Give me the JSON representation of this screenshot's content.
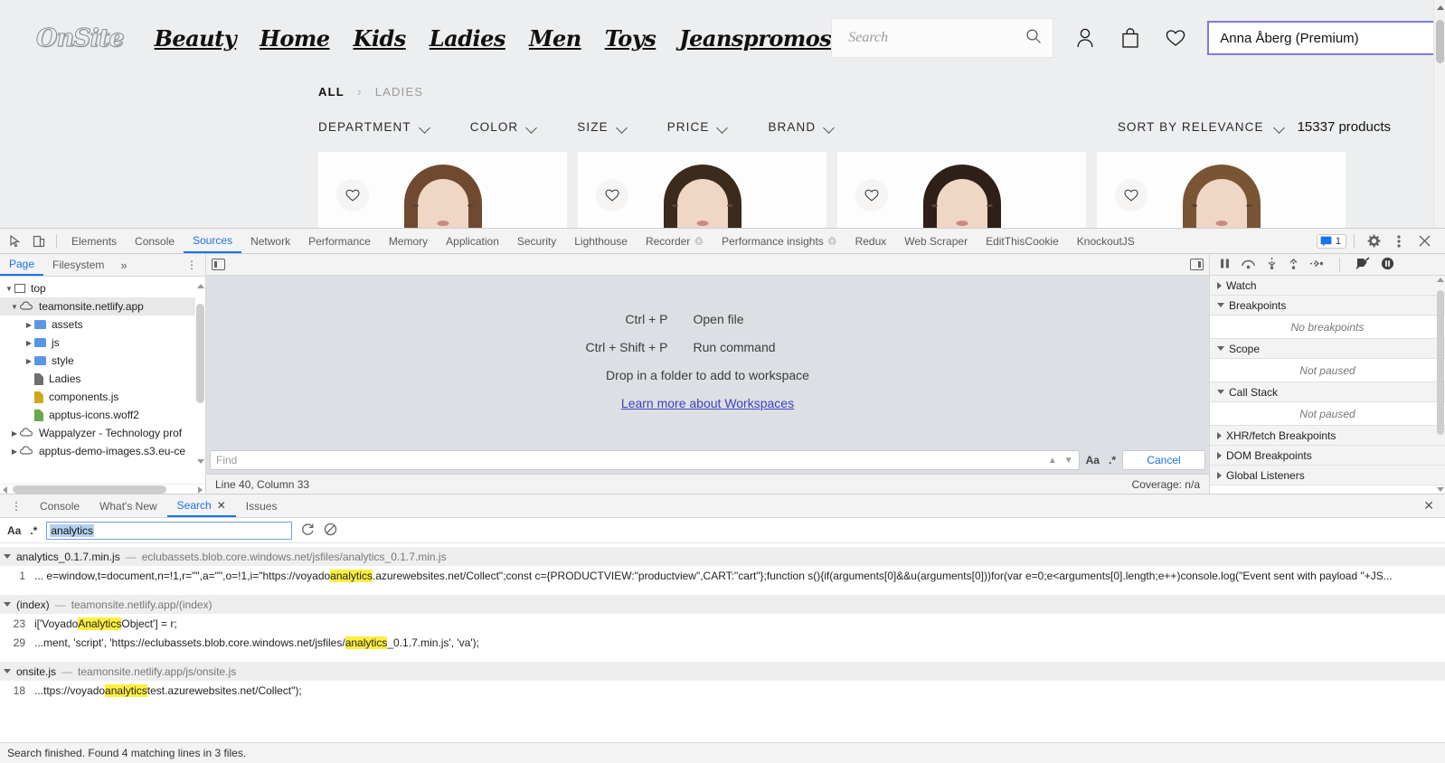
{
  "site": {
    "logo": "OnSite",
    "nav": [
      "Beauty",
      "Home",
      "Kids",
      "Ladies",
      "Men",
      "Toys",
      "Jeanspromos"
    ],
    "search_placeholder": "Search",
    "user_select_value": "Anna Åberg (Premium)",
    "breadcrumb": {
      "root": "ALL",
      "separator": "›",
      "current": "LADIES"
    },
    "filters": [
      "DEPARTMENT",
      "COLOR",
      "SIZE",
      "PRICE",
      "BRAND"
    ],
    "sort_label": "SORT BY RELEVANCE",
    "product_count": "15337 products",
    "cards": [
      {
        "hair": "#6f4a30"
      },
      {
        "hair": "#3c2a1c"
      },
      {
        "hair": "#2e2018"
      },
      {
        "hair": "#7a5535"
      }
    ]
  },
  "devtools": {
    "tabs": [
      {
        "label": "Elements",
        "active": false,
        "beaker": false
      },
      {
        "label": "Console",
        "active": false,
        "beaker": false
      },
      {
        "label": "Sources",
        "active": true,
        "beaker": false
      },
      {
        "label": "Network",
        "active": false,
        "beaker": false
      },
      {
        "label": "Performance",
        "active": false,
        "beaker": false
      },
      {
        "label": "Memory",
        "active": false,
        "beaker": false
      },
      {
        "label": "Application",
        "active": false,
        "beaker": false
      },
      {
        "label": "Security",
        "active": false,
        "beaker": false
      },
      {
        "label": "Lighthouse",
        "active": false,
        "beaker": false
      },
      {
        "label": "Recorder",
        "active": false,
        "beaker": true
      },
      {
        "label": "Performance insights",
        "active": false,
        "beaker": true
      },
      {
        "label": "Redux",
        "active": false,
        "beaker": false
      },
      {
        "label": "Web Scraper",
        "active": false,
        "beaker": false
      },
      {
        "label": "EditThisCookie",
        "active": false,
        "beaker": false
      },
      {
        "label": "KnockoutJS",
        "active": false,
        "beaker": false
      }
    ],
    "message_count": "1",
    "navigator": {
      "tabs": [
        {
          "label": "Page",
          "active": true
        },
        {
          "label": "Filesystem",
          "active": false
        }
      ],
      "more": "»",
      "tree": [
        {
          "label": "top",
          "kind": "frame",
          "indent": 0,
          "arrow": "down",
          "selected": false
        },
        {
          "label": "teamonsite.netlify.app",
          "kind": "cloud",
          "indent": 1,
          "arrow": "down",
          "selected": true
        },
        {
          "label": "assets",
          "kind": "folder",
          "indent": 2,
          "arrow": "right",
          "selected": false
        },
        {
          "label": "js",
          "kind": "folder",
          "indent": 2,
          "arrow": "right",
          "selected": false
        },
        {
          "label": "style",
          "kind": "folder",
          "indent": 2,
          "arrow": "right",
          "selected": false
        },
        {
          "label": "Ladies",
          "kind": "doc-gray",
          "indent": 2,
          "arrow": "none",
          "selected": false
        },
        {
          "label": "components.js",
          "kind": "doc-yellow",
          "indent": 2,
          "arrow": "none",
          "selected": false
        },
        {
          "label": "apptus-icons.woff2",
          "kind": "doc-green",
          "indent": 2,
          "arrow": "none",
          "selected": false
        },
        {
          "label": "Wappalyzer - Technology prof",
          "kind": "cloud",
          "indent": 1,
          "arrow": "right",
          "selected": false
        },
        {
          "label": "apptus-demo-images.s3.eu-ce",
          "kind": "cloud",
          "indent": 1,
          "arrow": "right",
          "selected": false
        }
      ]
    },
    "editor": {
      "shortcuts": [
        {
          "keys": "Ctrl + P",
          "desc": "Open file"
        },
        {
          "keys": "Ctrl + Shift + P",
          "desc": "Run command"
        }
      ],
      "drop_hint": "Drop in a folder to add to workspace",
      "workspaces_link": "Learn more about Workspaces",
      "find_placeholder": "Find",
      "find_match_case": "Aa",
      "find_regex": ".*",
      "find_cancel": "Cancel",
      "status_position": "Line 40, Column 33",
      "status_coverage": "Coverage: n/a"
    },
    "debugger": {
      "sections": [
        {
          "label": "Watch",
          "expanded": false,
          "empty": null
        },
        {
          "label": "Breakpoints",
          "expanded": true,
          "empty": "No breakpoints"
        },
        {
          "label": "Scope",
          "expanded": true,
          "empty": "Not paused"
        },
        {
          "label": "Call Stack",
          "expanded": true,
          "empty": "Not paused"
        },
        {
          "label": "XHR/fetch Breakpoints",
          "expanded": false,
          "empty": null
        },
        {
          "label": "DOM Breakpoints",
          "expanded": false,
          "empty": null
        },
        {
          "label": "Global Listeners",
          "expanded": false,
          "empty": null
        }
      ]
    },
    "drawer": {
      "tabs": [
        {
          "label": "Console",
          "active": false,
          "closable": false
        },
        {
          "label": "What's New",
          "active": false,
          "closable": false
        },
        {
          "label": "Search",
          "active": true,
          "closable": true
        },
        {
          "label": "Issues",
          "active": false,
          "closable": false
        }
      ],
      "match_case": "Aa",
      "regex": ".*",
      "query": "analytics",
      "status": "Search finished.  Found 4 matching lines in 3 files.",
      "results": [
        {
          "file": "analytics_0.1.7.min.js",
          "dash": "—",
          "url": "eclubassets.blob.core.windows.net/jsfiles/analytics_0.1.7.min.js",
          "lines": [
            {
              "number": "1",
              "parts": [
                {
                  "t": "... e=window,t=document,n=!1,r=\"\",a=\"\",o=!1,i=\"https://voyado",
                  "h": false
                },
                {
                  "t": "analytics",
                  "h": true
                },
                {
                  "t": ".azurewebsites.net/Collect\";const c={PRODUCTVIEW:\"productview\",CART:\"cart\"};function s(){if(arguments[0]&&u(arguments[0]))for(var e=0;e<arguments[0].length;e++)console.log(\"Event sent with payload \"+JS...",
                  "h": false
                }
              ]
            }
          ]
        },
        {
          "file": "(index)",
          "dash": "—",
          "url": "teamonsite.netlify.app/(index)",
          "lines": [
            {
              "number": "23",
              "parts": [
                {
                  "t": "i['Voyado",
                  "h": false
                },
                {
                  "t": "Analytics",
                  "h": true
                },
                {
                  "t": "Object'] = r;",
                  "h": false
                }
              ]
            },
            {
              "number": "29",
              "parts": [
                {
                  "t": "...ment, 'script', 'https://eclubassets.blob.core.windows.net/jsfiles/",
                  "h": false
                },
                {
                  "t": "analytics",
                  "h": true
                },
                {
                  "t": "_0.1.7.min.js', 'va');",
                  "h": false
                }
              ]
            }
          ]
        },
        {
          "file": "onsite.js",
          "dash": "—",
          "url": "teamonsite.netlify.app/js/onsite.js",
          "lines": [
            {
              "number": "18",
              "parts": [
                {
                  "t": "...ttps://voyado",
                  "h": false
                },
                {
                  "t": "analytics",
                  "h": true
                },
                {
                  "t": "test.azurewebsites.net/Collect\");",
                  "h": false
                }
              ]
            }
          ]
        }
      ]
    }
  }
}
